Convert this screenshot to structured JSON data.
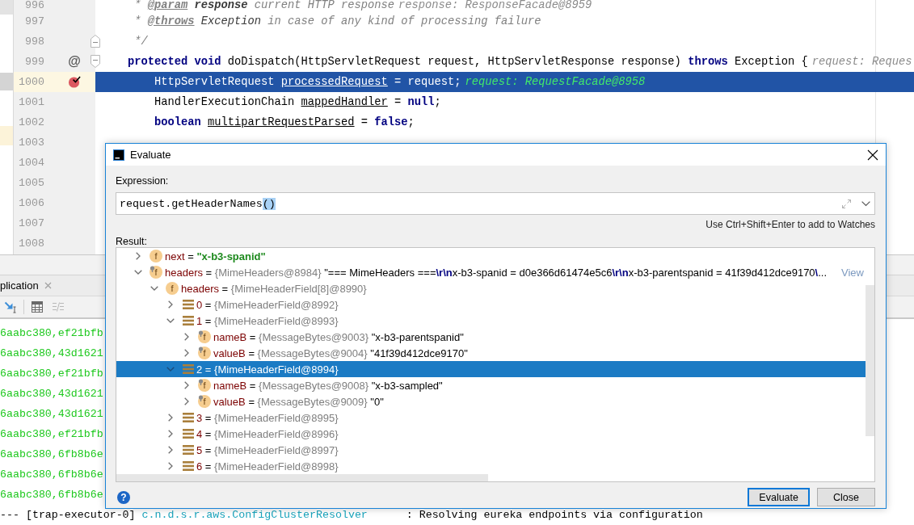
{
  "editor": {
    "lines": [
      {
        "number": "996",
        "kind": "doc",
        "current": false,
        "tokens": [
          {
            "text": "* ",
            "kind": "doc"
          },
          {
            "text": "@param",
            "kind": "doc_tag"
          },
          {
            "text": " response",
            "kind": "doc_param"
          },
          {
            "text": " current HTTP response",
            "kind": "doc"
          }
        ],
        "hint": "response: ResponseFacade@8959"
      },
      {
        "number": "997",
        "kind": "doc",
        "current": false,
        "tokens": [
          {
            "text": "* ",
            "kind": "doc"
          },
          {
            "text": "@throws",
            "kind": "doc_tag"
          },
          {
            "text": " Exception",
            "kind": "doc_ref"
          },
          {
            "text": " in case of any kind of processing failure",
            "kind": "doc"
          }
        ]
      },
      {
        "number": "998",
        "kind": "doc",
        "current": false,
        "fold": {
          "kind": "end"
        },
        "tokens": [
          {
            "text": "*/",
            "kind": "doc"
          }
        ]
      },
      {
        "number": "999",
        "kind": "declaration",
        "current": false,
        "fold": {
          "kind": "start"
        },
        "marker": {
          "kind": "override",
          "symbol": "@"
        },
        "tokens": [
          {
            "text": "protected",
            "kind": "keyword"
          },
          {
            "text": " void",
            "kind": "keyword"
          },
          {
            "text": " doDispatch(HttpServletRequest request, HttpServletResponse response) ",
            "kind": "plain"
          },
          {
            "text": "throws",
            "kind": "keyword"
          },
          {
            "text": " Exception {",
            "kind": "plain"
          }
        ],
        "hint": "request: Reques"
      },
      {
        "number": "1000",
        "kind": "statement",
        "current": true,
        "marker": {
          "kind": "breakpoint"
        },
        "tokens": [
          {
            "text": "HttpServletRequest ",
            "kind": "plain"
          },
          {
            "text": "processedRequest",
            "kind": "local"
          },
          {
            "text": " = request;",
            "kind": "plain"
          }
        ],
        "hint": "request: RequestFacade@8958"
      },
      {
        "number": "1001",
        "kind": "statement",
        "current": false,
        "tokens": [
          {
            "text": "HandlerExecutionChain ",
            "kind": "plain"
          },
          {
            "text": "mappedHandler",
            "kind": "local"
          },
          {
            "text": " = ",
            "kind": "plain"
          },
          {
            "text": "null",
            "kind": "keyword"
          },
          {
            "text": ";",
            "kind": "plain"
          }
        ]
      },
      {
        "number": "1002",
        "kind": "statement",
        "current": false,
        "tokens": [
          {
            "text": "boolean ",
            "kind": "keyword"
          },
          {
            "text": "multipartRequestParsed",
            "kind": "local"
          },
          {
            "text": " = ",
            "kind": "plain"
          },
          {
            "text": "false",
            "kind": "keyword"
          },
          {
            "text": ";",
            "kind": "plain"
          }
        ]
      },
      {
        "number": "1003",
        "kind": "empty",
        "current": false
      },
      {
        "number": "1004",
        "kind": "empty",
        "current": false
      },
      {
        "number": "1005",
        "kind": "empty",
        "current": false
      },
      {
        "number": "1006",
        "kind": "empty",
        "current": false
      },
      {
        "number": "1007",
        "kind": "empty",
        "current": false
      },
      {
        "number": "1008",
        "kind": "empty",
        "current": false
      }
    ]
  },
  "tool_window": {
    "tab": {
      "label": "plication"
    },
    "toolbar": [
      {
        "kind": "run_to_cursor",
        "disabled": false
      },
      {
        "kind": "separator"
      },
      {
        "kind": "evaluate_expression",
        "disabled": false
      },
      {
        "kind": "trace_stream",
        "disabled": true
      }
    ],
    "console": [
      {
        "tokens": [
          {
            "text": "6aabc380,ef21bfb",
            "kind": "trace"
          }
        ]
      },
      {
        "tokens": [
          {
            "text": "6aabc380,43d1621",
            "kind": "trace"
          }
        ]
      },
      {
        "tokens": [
          {
            "text": "6aabc380,ef21bfb",
            "kind": "trace"
          }
        ]
      },
      {
        "tokens": [
          {
            "text": "6aabc380,43d1621",
            "kind": "trace"
          }
        ]
      },
      {
        "tokens": [
          {
            "text": "6aabc380,43d1621",
            "kind": "trace"
          }
        ]
      },
      {
        "tokens": [
          {
            "text": "6aabc380,ef21bfb",
            "kind": "trace"
          }
        ]
      },
      {
        "tokens": [
          {
            "text": "6aabc380,6fb8b6e",
            "kind": "trace"
          }
        ]
      },
      {
        "tokens": [
          {
            "text": "6aabc380,6fb8b6e",
            "kind": "trace"
          }
        ]
      },
      {
        "tokens": [
          {
            "text": "6aabc380,6fb8b6e",
            "kind": "trace"
          }
        ]
      },
      {
        "tokens": [
          {
            "text": "--- [trap-executor-0] ",
            "kind": "plain"
          },
          {
            "text": "c.n.d.s.r.aws.ConfigClusterResolver",
            "kind": "logger"
          },
          {
            "text": "      : Resolving eureka endpoints via configuration",
            "kind": "plain"
          }
        ]
      }
    ]
  },
  "dialog": {
    "title": "Evaluate",
    "expression_label": "Expression:",
    "expression": [
      {
        "text": "request.getHeaderNames",
        "highlighted": false
      },
      {
        "text": "()",
        "highlighted": true
      }
    ],
    "hint": "Use Ctrl+Shift+Enter to add to Watches",
    "result_label": "Result:",
    "result": [
      {
        "kind": "field",
        "badge": "f",
        "pinned": false,
        "name": "next",
        "operator": "=",
        "value": "\"x-b3-spanid\"",
        "changed": true,
        "expanded": false,
        "selected": false
      },
      {
        "kind": "field",
        "badge": "f",
        "pinned": true,
        "name": "headers",
        "operator": "=",
        "type": "{MimeHeaders@8984}",
        "value": "\"=== MimeHeaders ===**\\r\\n**x-b3-spanid = d0e366d61474e5c6**\\r\\n**x-b3-parentspanid = 41f39d412dce9170**\\**...",
        "changed": false,
        "link": "View",
        "expanded": true,
        "selected": false,
        "children": [
          {
            "kind": "field",
            "badge": "f",
            "pinned": false,
            "name": "headers",
            "operator": "=",
            "type": "{MimeHeaderField[8]@8990}",
            "expanded": true,
            "selected": false,
            "children": [
              {
                "kind": "element",
                "name": "0",
                "operator": "=",
                "type": "{MimeHeaderField@8992}",
                "expanded": false,
                "selected": false
              },
              {
                "kind": "element",
                "name": "1",
                "operator": "=",
                "type": "{MimeHeaderField@8993}",
                "expanded": true,
                "selected": false,
                "children": [
                  {
                    "kind": "field",
                    "badge": "f",
                    "pinned": true,
                    "name": "nameB",
                    "operator": "=",
                    "type": "{MessageBytes@9003}",
                    "value": "\"x-b3-parentspanid\"",
                    "changed": false,
                    "expanded": false,
                    "selected": false
                  },
                  {
                    "kind": "field",
                    "badge": "f",
                    "pinned": true,
                    "name": "valueB",
                    "operator": "=",
                    "type": "{MessageBytes@9004}",
                    "value": "\"41f39d412dce9170\"",
                    "changed": false,
                    "expanded": false,
                    "selected": false
                  }
                ]
              },
              {
                "kind": "element",
                "name": "2",
                "operator": "=",
                "type": "{MimeHeaderField@8994}",
                "expanded": true,
                "selected": true,
                "children": [
                  {
                    "kind": "field",
                    "badge": "f",
                    "pinned": true,
                    "name": "nameB",
                    "operator": "=",
                    "type": "{MessageBytes@9008}",
                    "value": "\"x-b3-sampled\"",
                    "changed": false,
                    "expanded": false,
                    "selected": false
                  },
                  {
                    "kind": "field",
                    "badge": "f",
                    "pinned": true,
                    "name": "valueB",
                    "operator": "=",
                    "type": "{MessageBytes@9009}",
                    "value": "\"0\"",
                    "changed": false,
                    "expanded": false,
                    "selected": false
                  }
                ]
              },
              {
                "kind": "element",
                "name": "3",
                "operator": "=",
                "type": "{MimeHeaderField@8995}",
                "expanded": false,
                "selected": false
              },
              {
                "kind": "element",
                "name": "4",
                "operator": "=",
                "type": "{MimeHeaderField@8996}",
                "expanded": false,
                "selected": false
              },
              {
                "kind": "element",
                "name": "5",
                "operator": "=",
                "type": "{MimeHeaderField@8997}",
                "expanded": false,
                "selected": false
              },
              {
                "kind": "element",
                "name": "6",
                "operator": "=",
                "type": "{MimeHeaderField@8998}",
                "expanded": false,
                "selected": false
              }
            ]
          }
        ]
      }
    ],
    "help": "?",
    "buttons": [
      {
        "label": "Evaluate",
        "default": true
      },
      {
        "label": "Close",
        "default": false
      }
    ]
  }
}
